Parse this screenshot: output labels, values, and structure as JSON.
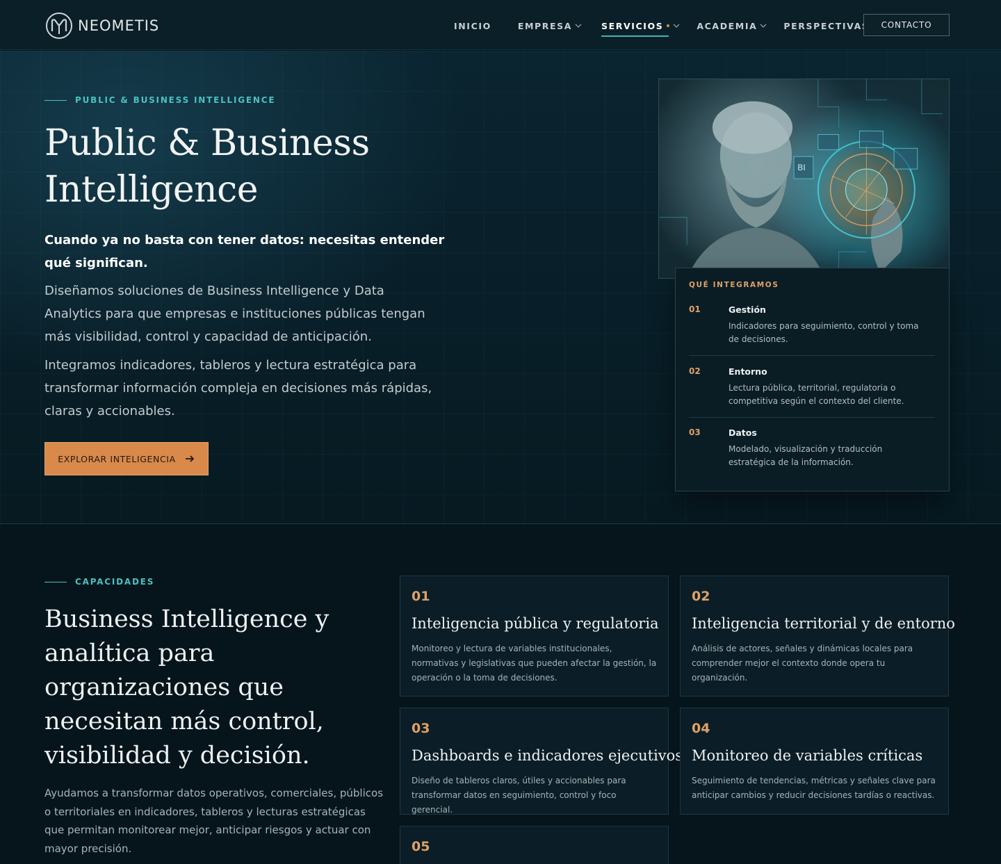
{
  "header": {
    "logo_text": "NEOMETIS",
    "nav": [
      {
        "label": "INICIO",
        "dropdown": false,
        "active": false
      },
      {
        "label": "EMPRESA",
        "dropdown": true,
        "active": false
      },
      {
        "label": "SERVICIOS",
        "dropdown": true,
        "active": true
      },
      {
        "label": "ACADEMIA",
        "dropdown": true,
        "active": false
      },
      {
        "label": "PERSPECTIVAS",
        "dropdown": true,
        "active": false
      }
    ],
    "contact_label": "CONTACTO"
  },
  "hero": {
    "eyebrow": "PUBLIC & BUSINESS INTELLIGENCE",
    "title": "Public & Business Intelligence",
    "lead": "Cuando ya no basta con tener datos: necesitas entender qué significan.",
    "paragraph_1": "Diseñamos soluciones de Business Intelligence y Data Analytics para que empresas e instituciones públicas tengan más visibilidad, control y capacidad de anticipación.",
    "paragraph_2": "Integramos indicadores, tableros y lectura estratégica para transformar información compleja en decisiones más rápidas, claras y accionables.",
    "cta_label": "EXPLORAR INTELIGENCIA",
    "image_overlay_text": "BI"
  },
  "integration": {
    "title": "QUÉ INTEGRAMOS",
    "items": [
      {
        "num": "01",
        "name": "Gestión",
        "desc": "Indicadores para seguimiento, control y toma de decisiones."
      },
      {
        "num": "02",
        "name": "Entorno",
        "desc": "Lectura pública, territorial, regulatoria o competitiva según el contexto del cliente."
      },
      {
        "num": "03",
        "name": "Datos",
        "desc": "Modelado, visualización y traducción estratégica de la información."
      }
    ]
  },
  "capabilities": {
    "eyebrow": "CAPACIDADES",
    "title": "Business Intelligence y analítica para organizaciones que necesitan más control, visibilidad y decisión.",
    "paragraph": "Ayudamos a transformar datos operativos, comerciales, públicos o territoriales en indicadores, tableros y lecturas estratégicas que permitan monitorear mejor, anticipar riesgos y actuar con mayor precisión.",
    "cards": [
      {
        "num": "01",
        "name": "Inteligencia pública y regulatoria",
        "desc": "Monitoreo y lectura de variables institucionales, normativas y legislativas que pueden afectar la gestión, la operación o la toma de decisiones."
      },
      {
        "num": "02",
        "name": "Inteligencia territorial y de entorno",
        "desc": "Análisis de actores, señales y dinámicas locales para comprender mejor el contexto donde opera tu organización."
      },
      {
        "num": "03",
        "name": "Dashboards e indicadores ejecutivos",
        "desc": "Diseño de tableros claros, útiles y accionables para transformar datos en seguimiento, control y foco gerencial."
      },
      {
        "num": "04",
        "name": "Monitoreo de variables críticas",
        "desc": "Seguimiento de tendencias, métricas y señales clave para anticipar cambios y reducir decisiones tardías o reactivas."
      },
      {
        "num": "05",
        "name": "",
        "desc": ""
      }
    ]
  },
  "colors": {
    "accent_orange": "#e0a167",
    "accent_teal": "#4cc0bf",
    "cta_bg": "#d9894a",
    "background": "#06151c"
  }
}
